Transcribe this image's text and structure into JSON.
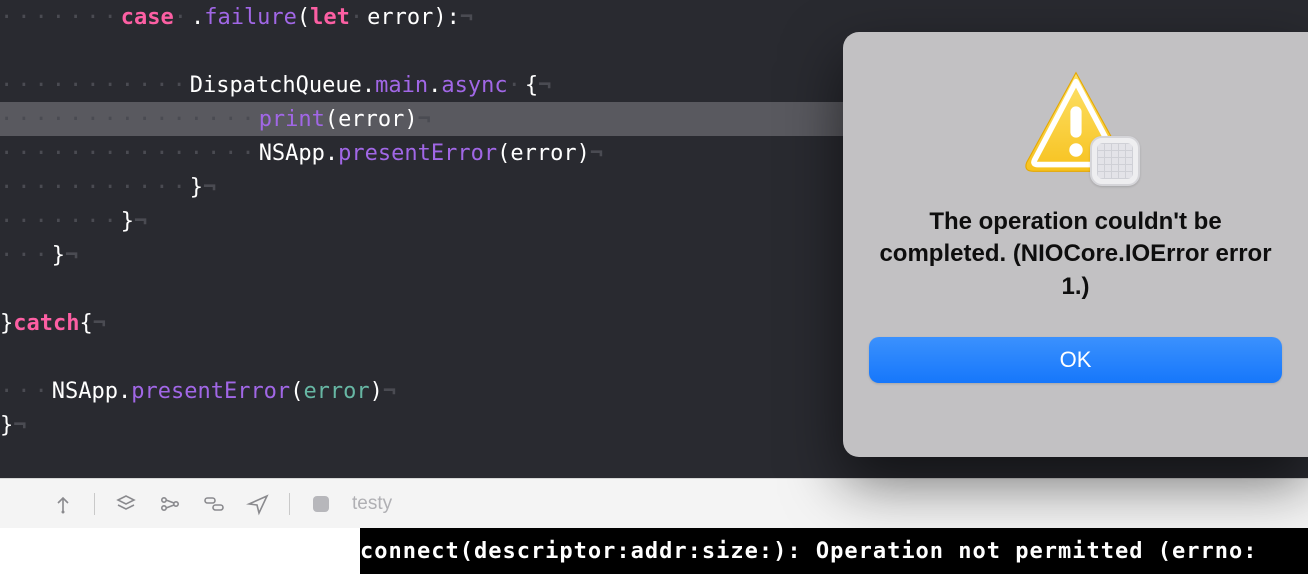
{
  "editor": {
    "lines": [
      {
        "ws": "·······",
        "segments": [
          {
            "cls": "kw",
            "t": "case"
          },
          {
            "cls": "ws",
            "t": "·"
          },
          {
            "cls": "dot",
            "t": "."
          },
          {
            "cls": "prop",
            "t": "failure"
          },
          {
            "cls": "paren",
            "t": "("
          },
          {
            "cls": "kw",
            "t": "let"
          },
          {
            "cls": "ws",
            "t": "·"
          },
          {
            "cls": "id",
            "t": "error"
          },
          {
            "cls": "paren",
            "t": "):"
          }
        ],
        "nl": "¬",
        "hl": false
      },
      {
        "ws": "",
        "segments": [],
        "nl": "",
        "hl": false
      },
      {
        "ws": "···········",
        "segments": [
          {
            "cls": "id",
            "t": "DispatchQueue"
          },
          {
            "cls": "dot",
            "t": "."
          },
          {
            "cls": "prop",
            "t": "main"
          },
          {
            "cls": "dot",
            "t": "."
          },
          {
            "cls": "prop",
            "t": "async"
          },
          {
            "cls": "ws",
            "t": "·"
          },
          {
            "cls": "brace",
            "t": "{"
          }
        ],
        "nl": "¬",
        "hl": false
      },
      {
        "ws": "···············",
        "segments": [
          {
            "cls": "fn",
            "t": "print"
          },
          {
            "cls": "paren",
            "t": "("
          },
          {
            "cls": "id",
            "t": "error"
          },
          {
            "cls": "paren",
            "t": ")"
          }
        ],
        "nl": "¬",
        "hl": true
      },
      {
        "ws": "···············",
        "segments": [
          {
            "cls": "id",
            "t": "NSApp"
          },
          {
            "cls": "dot",
            "t": "."
          },
          {
            "cls": "fn",
            "t": "presentError"
          },
          {
            "cls": "paren",
            "t": "("
          },
          {
            "cls": "id",
            "t": "error"
          },
          {
            "cls": "paren",
            "t": ")"
          }
        ],
        "nl": "¬",
        "hl": false
      },
      {
        "ws": "···········",
        "segments": [
          {
            "cls": "brace",
            "t": "}"
          }
        ],
        "nl": "¬",
        "hl": false
      },
      {
        "ws": "·······",
        "segments": [
          {
            "cls": "brace",
            "t": "}"
          }
        ],
        "nl": "¬",
        "hl": false
      },
      {
        "ws": "···",
        "segments": [
          {
            "cls": "brace",
            "t": "}"
          }
        ],
        "nl": "¬",
        "hl": false
      },
      {
        "ws": "",
        "segments": [],
        "nl": "",
        "hl": false
      },
      {
        "ws": "",
        "segments": [
          {
            "cls": "brace",
            "t": "}"
          },
          {
            "cls": "kw",
            "t": "catch"
          },
          {
            "cls": "brace",
            "t": "{"
          }
        ],
        "nl": "¬",
        "hl": false
      },
      {
        "ws": "",
        "segments": [],
        "nl": "",
        "hl": false
      },
      {
        "ws": "···",
        "segments": [
          {
            "cls": "id",
            "t": "NSApp"
          },
          {
            "cls": "dot",
            "t": "."
          },
          {
            "cls": "fn",
            "t": "presentError"
          },
          {
            "cls": "paren",
            "t": "("
          },
          {
            "cls": "arg",
            "t": "error"
          },
          {
            "cls": "paren",
            "t": ")"
          }
        ],
        "nl": "¬",
        "hl": false
      },
      {
        "ws": "",
        "segments": [
          {
            "cls": "brace",
            "t": "}"
          }
        ],
        "nl": "¬",
        "hl": false
      }
    ]
  },
  "debugbar": {
    "scheme": "testy"
  },
  "console": {
    "text": "connect(descriptor:addr:size:): Operation not permitted (errno:"
  },
  "alert": {
    "message": "The operation couldn't be completed. (NIOCore.IOError error 1.)",
    "ok": "OK"
  }
}
